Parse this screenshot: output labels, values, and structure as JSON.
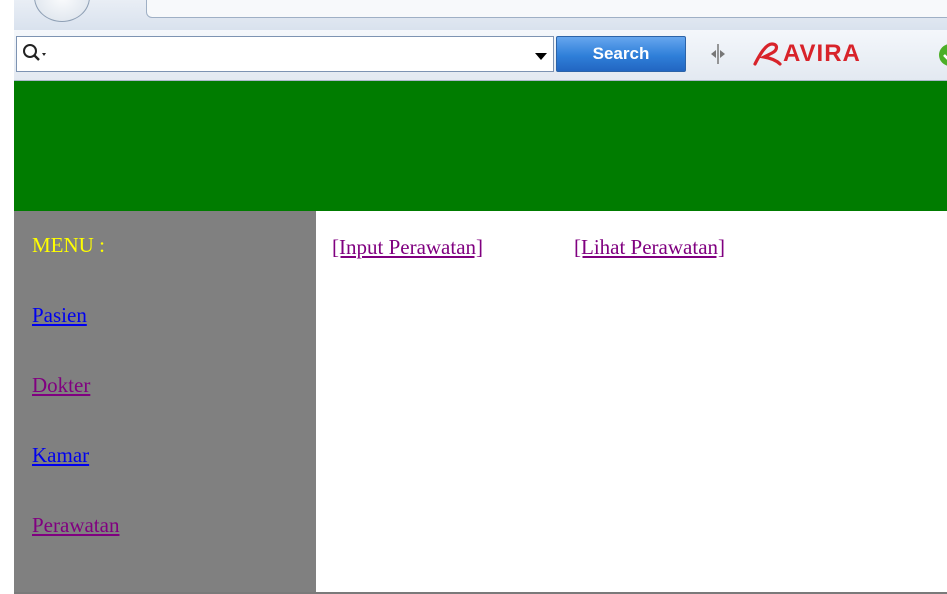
{
  "toolbar": {
    "search_placeholder": "",
    "search_button_label": "Search",
    "brand_name": "AVIRA",
    "brand_color": "#d8232a"
  },
  "colors": {
    "header_banner": "#007c00",
    "sidebar": "#808080",
    "menu_title": "#ffff00",
    "link": "#0000ee",
    "visited_link": "#800080"
  },
  "sidebar": {
    "title": "MENU :",
    "items": [
      {
        "label": "Pasien",
        "state": "unvisited"
      },
      {
        "label": "Dokter",
        "state": "visited"
      },
      {
        "label": "Kamar",
        "state": "unvisited"
      },
      {
        "label": "Perawatan",
        "state": "visited"
      }
    ]
  },
  "main": {
    "links": [
      {
        "label": "[Input Perawatan]"
      },
      {
        "label": "[Lihat Perawatan]"
      }
    ]
  },
  "icons": {
    "search": "search-icon",
    "dropdown": "chevron-down-icon",
    "grip": "grip-icon",
    "status": "check-circle-icon"
  }
}
